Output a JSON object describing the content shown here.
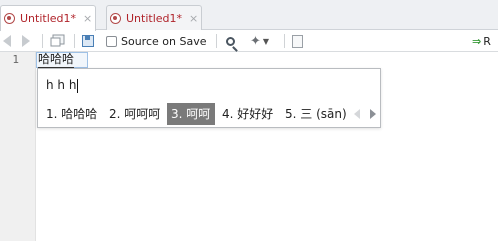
{
  "tabs": [
    {
      "label": "Untitled1*",
      "active": true
    },
    {
      "label": "Untitled1*",
      "active": false
    }
  ],
  "tab_close_glyph": "×",
  "toolbar": {
    "source_on_save_label": "Source on Save",
    "run_label": "R"
  },
  "editor": {
    "line_numbers": [
      "1"
    ],
    "line1_text": "哈哈哈"
  },
  "ime": {
    "preedit": "h h h",
    "candidates": [
      {
        "label": "1. 哈哈哈",
        "selected": false
      },
      {
        "label": "2. 呵呵呵",
        "selected": false
      },
      {
        "label": "3. 呵呵",
        "selected": true
      },
      {
        "label": "4. 好好好",
        "selected": false
      },
      {
        "label": "5. 三 (sān)",
        "selected": false
      }
    ]
  },
  "colors": {
    "tab_text": "#b0232a",
    "selected_candidate_bg": "#7a7a7a",
    "run_arrow": "#3a9a3a"
  }
}
